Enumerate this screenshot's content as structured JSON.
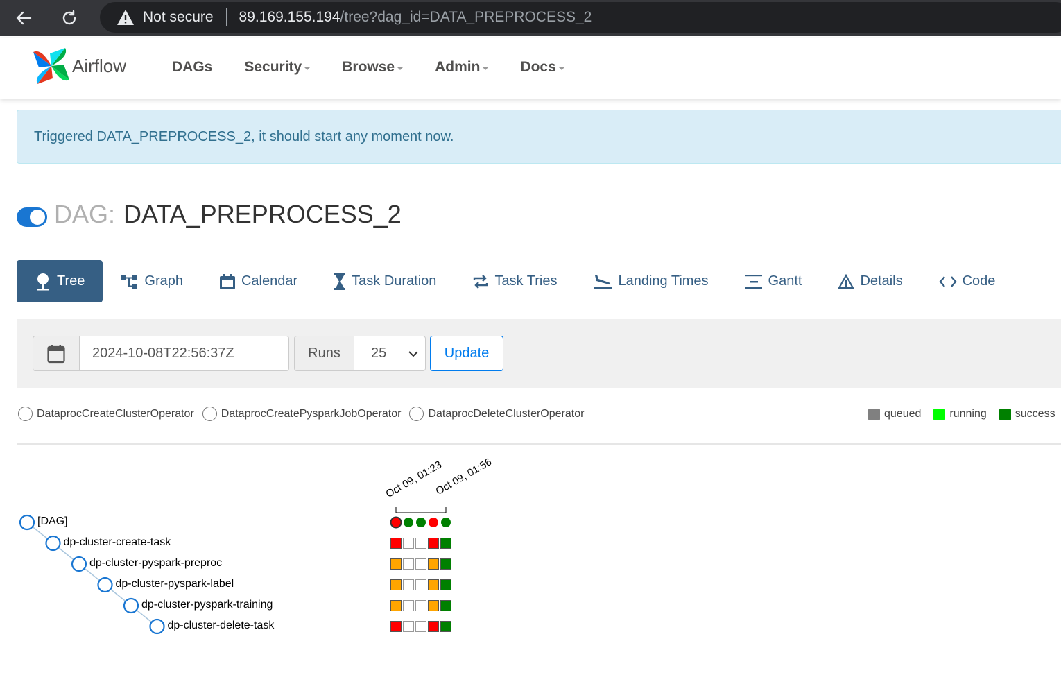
{
  "browser": {
    "not_secure": "Not secure",
    "host": "89.169.155.194",
    "path": "/tree?dag_id=DATA_PREPROCESS_2"
  },
  "navbar": {
    "brand": "Airflow",
    "menu": [
      {
        "label": "DAGs",
        "dropdown": false
      },
      {
        "label": "Security",
        "dropdown": true
      },
      {
        "label": "Browse",
        "dropdown": true
      },
      {
        "label": "Admin",
        "dropdown": true
      },
      {
        "label": "Docs",
        "dropdown": true
      }
    ]
  },
  "alert": {
    "text": "Triggered DATA_PREPROCESS_2, it should start any moment now."
  },
  "dag": {
    "prefix": "DAG:",
    "name": "DATA_PREPROCESS_2",
    "paused": false
  },
  "tabs": [
    {
      "label": "Tree",
      "icon": "tree-icon",
      "active": true
    },
    {
      "label": "Graph",
      "icon": "graph-icon",
      "active": false
    },
    {
      "label": "Calendar",
      "icon": "calendar-icon",
      "active": false
    },
    {
      "label": "Task Duration",
      "icon": "hourglass-icon",
      "active": false
    },
    {
      "label": "Task Tries",
      "icon": "retry-icon",
      "active": false
    },
    {
      "label": "Landing Times",
      "icon": "plane-landing-icon",
      "active": false
    },
    {
      "label": "Gantt",
      "icon": "gantt-icon",
      "active": false
    },
    {
      "label": "Details",
      "icon": "warning-triangle-icon",
      "active": false
    },
    {
      "label": "Code",
      "icon": "code-icon",
      "active": false
    }
  ],
  "controls": {
    "base_date": "2024-10-08T22:56:37Z",
    "runs_label": "Runs",
    "runs_value": "25",
    "update_label": "Update"
  },
  "operators": [
    "DataprocCreateClusterOperator",
    "DataprocCreatePysparkJobOperator",
    "DataprocDeleteClusterOperator"
  ],
  "states": [
    {
      "label": "queued",
      "color": "#808080"
    },
    {
      "label": "running",
      "color": "#00ff00"
    },
    {
      "label": "success",
      "color": "#008000"
    }
  ],
  "run_dates": [
    "Oct 09, 01:23",
    "Oct 09, 01:56"
  ],
  "state_colors": {
    "failed": "#ff0000",
    "success": "#008000",
    "upstream_failed": "#ffa500",
    "none": "#ffffff"
  },
  "dag_runs": [
    "failed",
    "success",
    "success",
    "failed",
    "success"
  ],
  "tasks": [
    {
      "name": "[DAG]",
      "runs": null
    },
    {
      "name": "dp-cluster-create-task",
      "runs": [
        "failed",
        "none",
        "none",
        "failed",
        "success"
      ]
    },
    {
      "name": "dp-cluster-pyspark-preproc",
      "runs": [
        "upstream_failed",
        "none",
        "none",
        "upstream_failed",
        "success"
      ]
    },
    {
      "name": "dp-cluster-pyspark-label",
      "runs": [
        "upstream_failed",
        "none",
        "none",
        "upstream_failed",
        "success"
      ]
    },
    {
      "name": "dp-cluster-pyspark-training",
      "runs": [
        "upstream_failed",
        "none",
        "none",
        "upstream_failed",
        "success"
      ]
    },
    {
      "name": "dp-cluster-delete-task",
      "runs": [
        "failed",
        "none",
        "none",
        "failed",
        "success"
      ]
    }
  ]
}
